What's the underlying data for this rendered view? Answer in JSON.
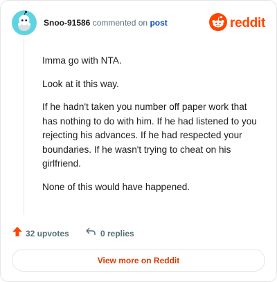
{
  "header": {
    "username": "Snoo-91586",
    "action": "commented on",
    "post_link": "post",
    "brand": "reddit"
  },
  "comment": {
    "paragraphs": [
      "Imma go with NTA.",
      "Look at it this way.",
      "If he hadn't taken you number off paper work that has nothing to do with him. If he had listened to you rejecting his advances. If he had respected your boundaries. If he wasn't trying to cheat on his girlfriend.",
      "None of this would have happened."
    ]
  },
  "footer": {
    "upvotes": "32 upvotes",
    "replies": "0 replies"
  },
  "cta": {
    "label": "View more on Reddit"
  },
  "colors": {
    "brand": "#ff4500",
    "link": "#0a4ec2",
    "cta_text": "#d93a00",
    "avatar_bg": "#5ed4e0"
  },
  "icons": {
    "avatar": "snoo-avatar-icon",
    "brand": "reddit-logo-icon",
    "upvote": "upvote-arrow-icon",
    "reply": "reply-arrow-icon"
  }
}
